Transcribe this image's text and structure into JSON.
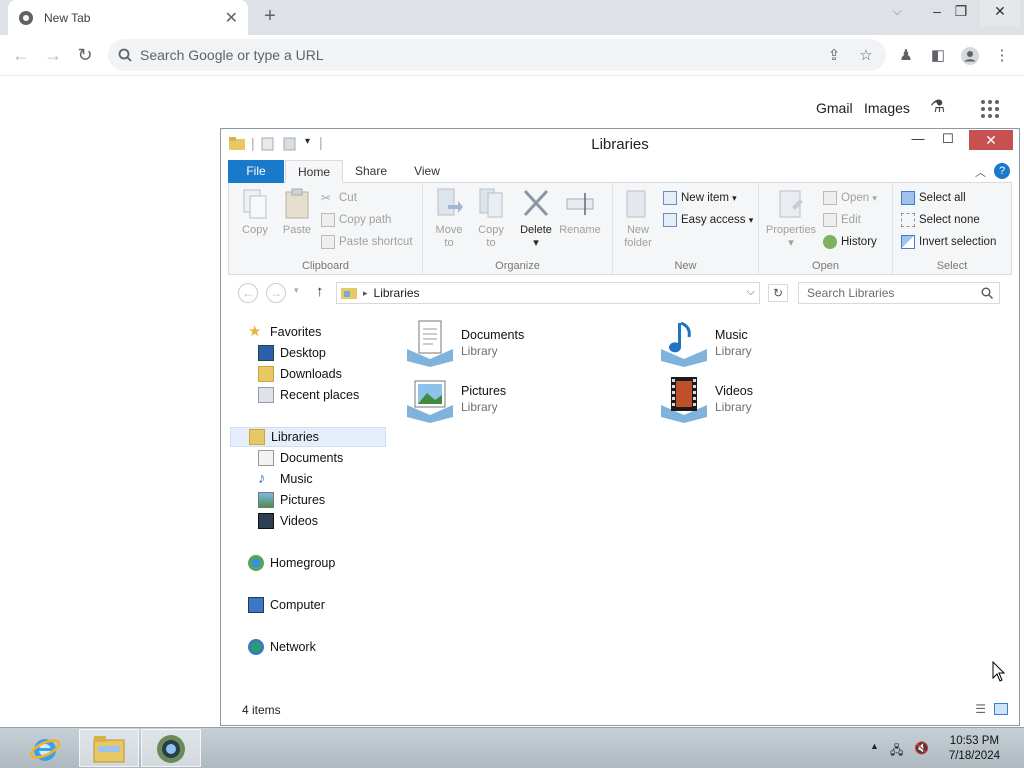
{
  "chrome": {
    "tab_title": "New Tab",
    "omnibox_placeholder": "Search Google or type a URL",
    "links": {
      "gmail": "Gmail",
      "images": "Images"
    }
  },
  "explorer": {
    "title": "Libraries",
    "ribbon_tabs": {
      "file": "File",
      "home": "Home",
      "share": "Share",
      "view": "View"
    },
    "clipboard": {
      "copy": "Copy",
      "paste": "Paste",
      "cut": "Cut",
      "copy_path": "Copy path",
      "paste_shortcut": "Paste shortcut",
      "label": "Clipboard"
    },
    "organize": {
      "move_to": "Move",
      "move_to2": "to",
      "copy_to": "Copy",
      "copy_to2": "to",
      "delete": "Delete",
      "rename": "Rename",
      "label": "Organize"
    },
    "new": {
      "new_folder": "New",
      "new_folder2": "folder",
      "new_item": "New item",
      "easy_access": "Easy access",
      "label": "New"
    },
    "open": {
      "properties": "Properties",
      "open": "Open",
      "edit": "Edit",
      "history": "History",
      "label": "Open"
    },
    "select": {
      "select_all": "Select all",
      "select_none": "Select none",
      "invert": "Invert selection",
      "label": "Select"
    },
    "address": {
      "crumb": "Libraries",
      "search_placeholder": "Search Libraries"
    },
    "nav": {
      "favorites": "Favorites",
      "desktop": "Desktop",
      "downloads": "Downloads",
      "recent": "Recent places",
      "libraries": "Libraries",
      "documents": "Documents",
      "music": "Music",
      "pictures": "Pictures",
      "videos": "Videos",
      "homegroup": "Homegroup",
      "computer": "Computer",
      "network": "Network"
    },
    "libraries": [
      {
        "name": "Documents",
        "type": "Library"
      },
      {
        "name": "Music",
        "type": "Library"
      },
      {
        "name": "Pictures",
        "type": "Library"
      },
      {
        "name": "Videos",
        "type": "Library"
      }
    ],
    "status": "4 items"
  },
  "taskbar": {
    "time": "10:53 PM",
    "date": "7/18/2024"
  }
}
